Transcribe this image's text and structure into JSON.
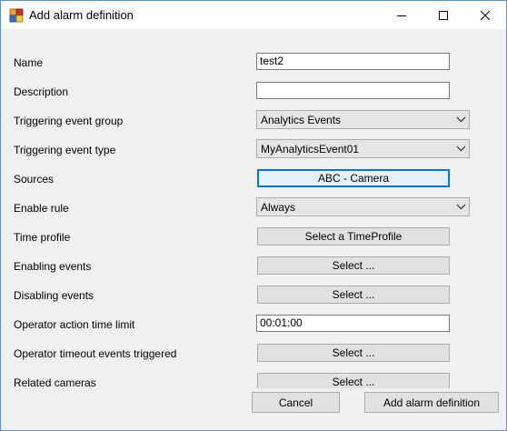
{
  "window": {
    "title": "Add alarm definition"
  },
  "icons": {
    "app": "app-icon",
    "minimize": "minimize-icon",
    "maximize": "maximize-icon",
    "close": "close-icon"
  },
  "form": {
    "name": {
      "label": "Name",
      "value": "test2"
    },
    "description": {
      "label": "Description",
      "value": ""
    },
    "triggering_event_group": {
      "label": "Triggering event group",
      "value": "Analytics Events"
    },
    "triggering_event_type": {
      "label": "Triggering event type",
      "value": "MyAnalyticsEvent01"
    },
    "sources": {
      "label": "Sources",
      "button": "ABC - Camera"
    },
    "enable_rule": {
      "label": "Enable rule",
      "value": "Always"
    },
    "time_profile": {
      "label": "Time profile",
      "button": "Select a TimeProfile"
    },
    "enabling_events": {
      "label": "Enabling events",
      "button": "Select ..."
    },
    "disabling_events": {
      "label": "Disabling events",
      "button": "Select ..."
    },
    "operator_action_time_limit": {
      "label": "Operator action time limit",
      "value": "00:01:00"
    },
    "operator_timeout_events": {
      "label": "Operator timeout events triggered",
      "button": "Select ..."
    },
    "related_cameras": {
      "label": "Related cameras",
      "button": "Select ..."
    }
  },
  "footer": {
    "cancel": "Cancel",
    "add": "Add alarm definition"
  }
}
